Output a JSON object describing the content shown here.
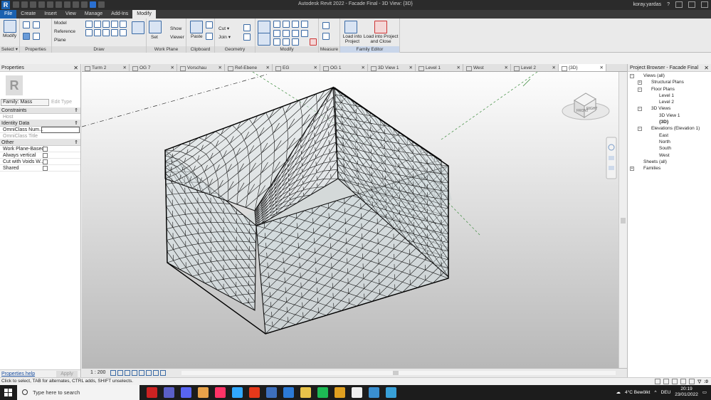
{
  "titlebar": {
    "title": "Autodesk Revit 2022 - Facade Final - 3D View: {3D}",
    "user": "koray.yardas"
  },
  "ribbon_tabs": [
    "File",
    "Create",
    "Insert",
    "View",
    "Manage",
    "Add-Ins",
    "Modify"
  ],
  "ribbon": {
    "modify_label": "Modify",
    "select_label": "Select ▾",
    "properties_label": "Properties",
    "draw": {
      "model": "Model",
      "reference": "Reference",
      "plane": "Plane",
      "label": "Draw"
    },
    "workplane": {
      "set": "Set",
      "show": "Show",
      "viewer": "Viewer",
      "label": "Work Plane"
    },
    "clipboard": {
      "paste": "Paste",
      "label": "Clipboard"
    },
    "geometry": {
      "cut": "Cut ▾",
      "join": "Join ▾",
      "label": "Geometry"
    },
    "modify_panel_label": "Modify",
    "measure_label": "Measure",
    "family_editor": {
      "load_into_project": "Load into Project",
      "load_into_project_close": "Load into Project and Close",
      "label": "Family Editor"
    }
  },
  "properties": {
    "title": "Properties",
    "family_type": "Family: Mass",
    "edit_type": "Edit Type",
    "sections": [
      {
        "name": "Constraints",
        "rows": [
          {
            "label": "Host",
            "grey": true,
            "kind": "text"
          }
        ]
      },
      {
        "name": "Identity Data",
        "rows": [
          {
            "label": "OmniClass Num...",
            "grey": false,
            "kind": "boxed"
          },
          {
            "label": "OmniClass Title",
            "grey": true,
            "kind": "text"
          }
        ]
      },
      {
        "name": "Other",
        "rows": [
          {
            "label": "Work Plane-Based",
            "grey": false,
            "kind": "checkbox"
          },
          {
            "label": "Always vertical",
            "grey": false,
            "kind": "checkbox"
          },
          {
            "label": "Cut with Voids W...",
            "grey": false,
            "kind": "checkbox"
          },
          {
            "label": "Shared",
            "grey": false,
            "kind": "checkbox"
          }
        ]
      }
    ],
    "help_link": "Properties help",
    "apply": "Apply"
  },
  "view_tabs": [
    {
      "label": "Turm 2",
      "active": false
    },
    {
      "label": "OG 7",
      "active": false
    },
    {
      "label": "Vorschau",
      "active": false
    },
    {
      "label": "Ref-Ebene",
      "active": false
    },
    {
      "label": "EG",
      "active": false
    },
    {
      "label": "OG 1",
      "active": false
    },
    {
      "label": "3D View 1",
      "active": false
    },
    {
      "label": "Level 1",
      "active": false
    },
    {
      "label": "West",
      "active": false
    },
    {
      "label": "Level 2",
      "active": false
    },
    {
      "label": "{3D}",
      "active": true
    }
  ],
  "viewcube": {
    "front": "FRONT",
    "right": "RIGHT"
  },
  "viewbar": {
    "scale": "1 : 200"
  },
  "browser": {
    "title": "Project Browser - Facade Final",
    "tree": [
      {
        "label": "Views (all)",
        "depth": 0,
        "exp": "−",
        "bold": false
      },
      {
        "label": "Structural Plans",
        "depth": 1,
        "exp": "+",
        "bold": false
      },
      {
        "label": "Floor Plans",
        "depth": 1,
        "exp": "−",
        "bold": false
      },
      {
        "label": "Level 1",
        "depth": 2,
        "exp": "",
        "bold": false
      },
      {
        "label": "Level 2",
        "depth": 2,
        "exp": "",
        "bold": false
      },
      {
        "label": "3D Views",
        "depth": 1,
        "exp": "−",
        "bold": false
      },
      {
        "label": "3D View 1",
        "depth": 2,
        "exp": "",
        "bold": false
      },
      {
        "label": "{3D}",
        "depth": 2,
        "exp": "",
        "bold": true
      },
      {
        "label": "Elevations (Elevation 1)",
        "depth": 1,
        "exp": "−",
        "bold": false
      },
      {
        "label": "East",
        "depth": 2,
        "exp": "",
        "bold": false
      },
      {
        "label": "North",
        "depth": 2,
        "exp": "",
        "bold": false
      },
      {
        "label": "South",
        "depth": 2,
        "exp": "",
        "bold": false
      },
      {
        "label": "West",
        "depth": 2,
        "exp": "",
        "bold": false
      },
      {
        "label": "Sheets (all)",
        "depth": 0,
        "exp": "",
        "bold": false
      },
      {
        "label": "Families",
        "depth": 0,
        "exp": "+",
        "bold": false
      }
    ]
  },
  "status": {
    "text": "Click to select, TAB for alternates, CTRL adds, SHIFT unselects.",
    "filter_count": ":0"
  },
  "taskbar": {
    "search_placeholder": "Type here to search",
    "weather": "4°C  Bewölkt",
    "lang": "DEU",
    "time": "20:19",
    "date": "23/01/2022",
    "app_colors": [
      "#cc2222",
      "#5a5fc7",
      "#5865f2",
      "#e8a24a",
      "#ff3366",
      "#31a8ff",
      "#e5381a",
      "#3d6fbd",
      "#2c7ad6",
      "#e8c34a",
      "#1db954",
      "#e0a020",
      "#eeeeee",
      "#3a8fd0",
      "#38a0d8"
    ]
  }
}
